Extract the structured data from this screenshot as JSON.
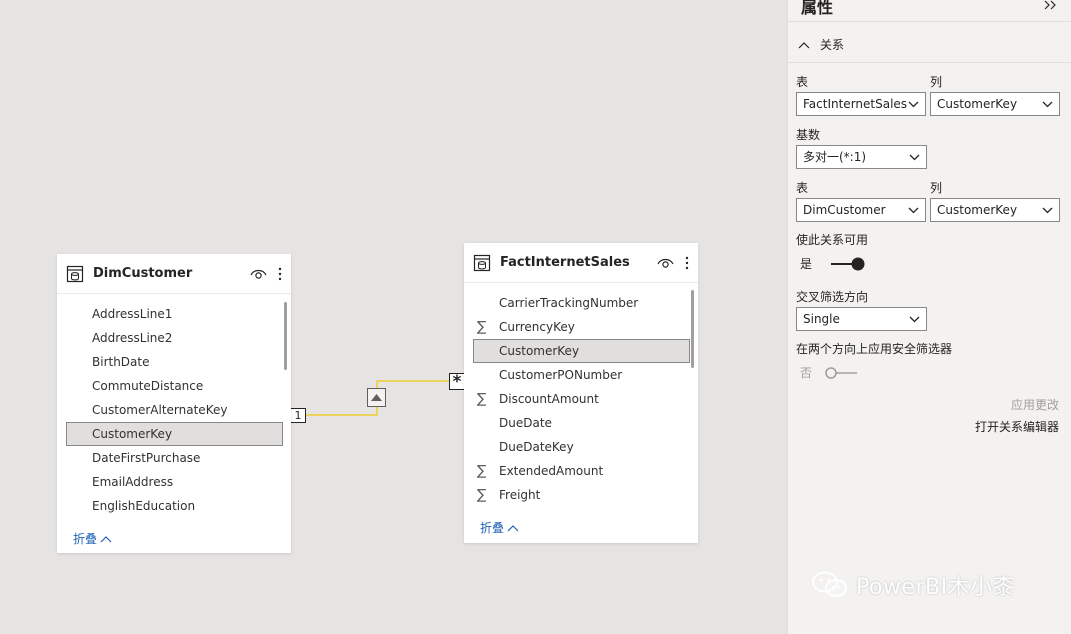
{
  "tables": {
    "dim_customer": {
      "title": "DimCustomer",
      "fields": [
        {
          "name": "AddressLine1",
          "type": "text"
        },
        {
          "name": "AddressLine2",
          "type": "text"
        },
        {
          "name": "BirthDate",
          "type": "text"
        },
        {
          "name": "CommuteDistance",
          "type": "text"
        },
        {
          "name": "CustomerAlternateKey",
          "type": "text"
        },
        {
          "name": "CustomerKey",
          "type": "text",
          "selected": true
        },
        {
          "name": "DateFirstPurchase",
          "type": "text"
        },
        {
          "name": "EmailAddress",
          "type": "text"
        },
        {
          "name": "EnglishEducation",
          "type": "text"
        }
      ],
      "collapse_label": "折叠"
    },
    "fact_internet_sales": {
      "title": "FactInternetSales",
      "fields": [
        {
          "name": "CarrierTrackingNumber",
          "type": "text"
        },
        {
          "name": "CurrencyKey",
          "type": "sum"
        },
        {
          "name": "CustomerKey",
          "type": "text",
          "selected": true
        },
        {
          "name": "CustomerPONumber",
          "type": "text"
        },
        {
          "name": "DiscountAmount",
          "type": "sum"
        },
        {
          "name": "DueDate",
          "type": "text"
        },
        {
          "name": "DueDateKey",
          "type": "text"
        },
        {
          "name": "ExtendedAmount",
          "type": "sum"
        },
        {
          "name": "Freight",
          "type": "sum"
        }
      ],
      "collapse_label": "折叠"
    }
  },
  "relationship": {
    "one_label": "1",
    "many_label": "*",
    "line_color": "#f2c811"
  },
  "icons": {
    "sum": "∑",
    "table": "table-icon",
    "visibility": "eye-icon",
    "more": "more-vertical-icon"
  },
  "properties_pane": {
    "title": "属性",
    "section": "关系",
    "table1_label": "表",
    "column1_label": "列",
    "table1_value": "FactInternetSales",
    "column1_value": "CustomerKey",
    "cardinality_label": "基数",
    "cardinality_value": "多对一(*:1)",
    "table2_label": "表",
    "column2_label": "列",
    "table2_value": "DimCustomer",
    "column2_value": "CustomerKey",
    "active_label": "使此关系可用",
    "active_state": "是",
    "active_on": true,
    "filter_dir_label": "交叉筛选方向",
    "filter_dir_value": "Single",
    "security_label": "在两个方向上应用安全筛选器",
    "security_state": "否",
    "security_on": false,
    "apply_label": "应用更改",
    "open_editor_label": "打开关系编辑器"
  },
  "watermark": {
    "text": "PowerBI木小桼"
  },
  "colors": {
    "canvas_bg": "#e5e4e3",
    "pane_bg": "#f3f2f1",
    "link_blue": "#2062b4",
    "toggle_dark": "#605e5c"
  }
}
